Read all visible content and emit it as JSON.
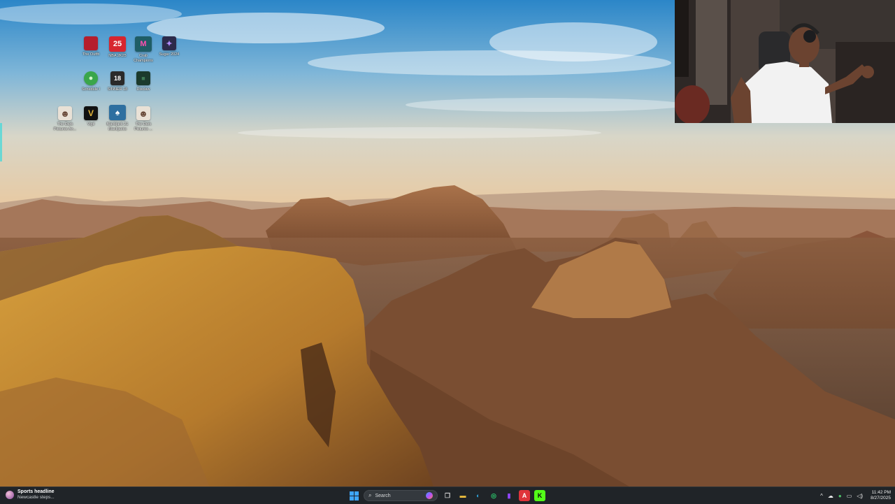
{
  "desktop_icons": [
    {
      "label": "The Outfit",
      "icon": "red-square-icon",
      "color": "#b51e2d",
      "glyph": ""
    },
    {
      "label": "NBA 2K25",
      "icon": "nba2k25-icon",
      "color": "#d7262f",
      "glyph": "25"
    },
    {
      "label": "Crab Champions",
      "icon": "crab-champions-icon",
      "color": "#1f5d66",
      "glyph": "M"
    },
    {
      "label": "Sugar 2024",
      "icon": "purple-logo-icon",
      "color": "#2c2a4a",
      "glyph": "✦"
    },
    {
      "label": "Schedule I",
      "icon": "globe-icon",
      "color": "#3aa64a",
      "glyph": "●"
    },
    {
      "label": "SINNER 18",
      "icon": "sinner-icon",
      "color": "#2a2a2a",
      "glyph": "18"
    },
    {
      "label": "Disclaw",
      "icon": "green-square-icon",
      "color": "#1b3a2c",
      "glyph": "■"
    },
    {
      "label": "The Dark Pictures An...",
      "icon": "dark-pictures-icon",
      "color": "#6a4a3a",
      "glyph": "☻"
    },
    {
      "label": "Vigil",
      "icon": "vigil-icon",
      "color": "#111111",
      "glyph": "V"
    },
    {
      "label": "Blackjack 21 Blackjacks",
      "icon": "blackjack-icon",
      "color": "#2e6fa0",
      "glyph": "♠"
    },
    {
      "label": "The Dark Pictures ...",
      "icon": "dark-pictures-icon",
      "color": "#6a4a3a",
      "glyph": "☻"
    }
  ],
  "taskbar": {
    "news_title": "Sports headline",
    "news_sub": "Newcastle steps...",
    "search_placeholder": "Search",
    "apps": [
      {
        "name": "task-view-icon",
        "glyph": "❐",
        "color": "#d0d0d0"
      },
      {
        "name": "file-explorer-icon",
        "glyph": "▬",
        "color": "#f3c23e"
      },
      {
        "name": "edge-browser-icon",
        "glyph": "◐",
        "color": "#2fa7e0"
      },
      {
        "name": "xbox-app-icon",
        "glyph": "◎",
        "color": "#2cc36b"
      },
      {
        "name": "twitch-icon",
        "glyph": "▮",
        "color": "#9146ff"
      },
      {
        "name": "acrobat-icon",
        "glyph": "A",
        "color": "#e0343b"
      },
      {
        "name": "kick-icon",
        "glyph": "K",
        "color": "#53fc18"
      }
    ],
    "time": "11:42 PM",
    "date": "8/27/2025",
    "tray": [
      {
        "name": "chevron-up-icon",
        "glyph": "^"
      },
      {
        "name": "onedrive-icon",
        "glyph": "☁"
      },
      {
        "name": "microphone-icon",
        "glyph": "●"
      },
      {
        "name": "network-icon",
        "glyph": "▭"
      },
      {
        "name": "speaker-icon",
        "glyph": "◁)"
      }
    ]
  }
}
